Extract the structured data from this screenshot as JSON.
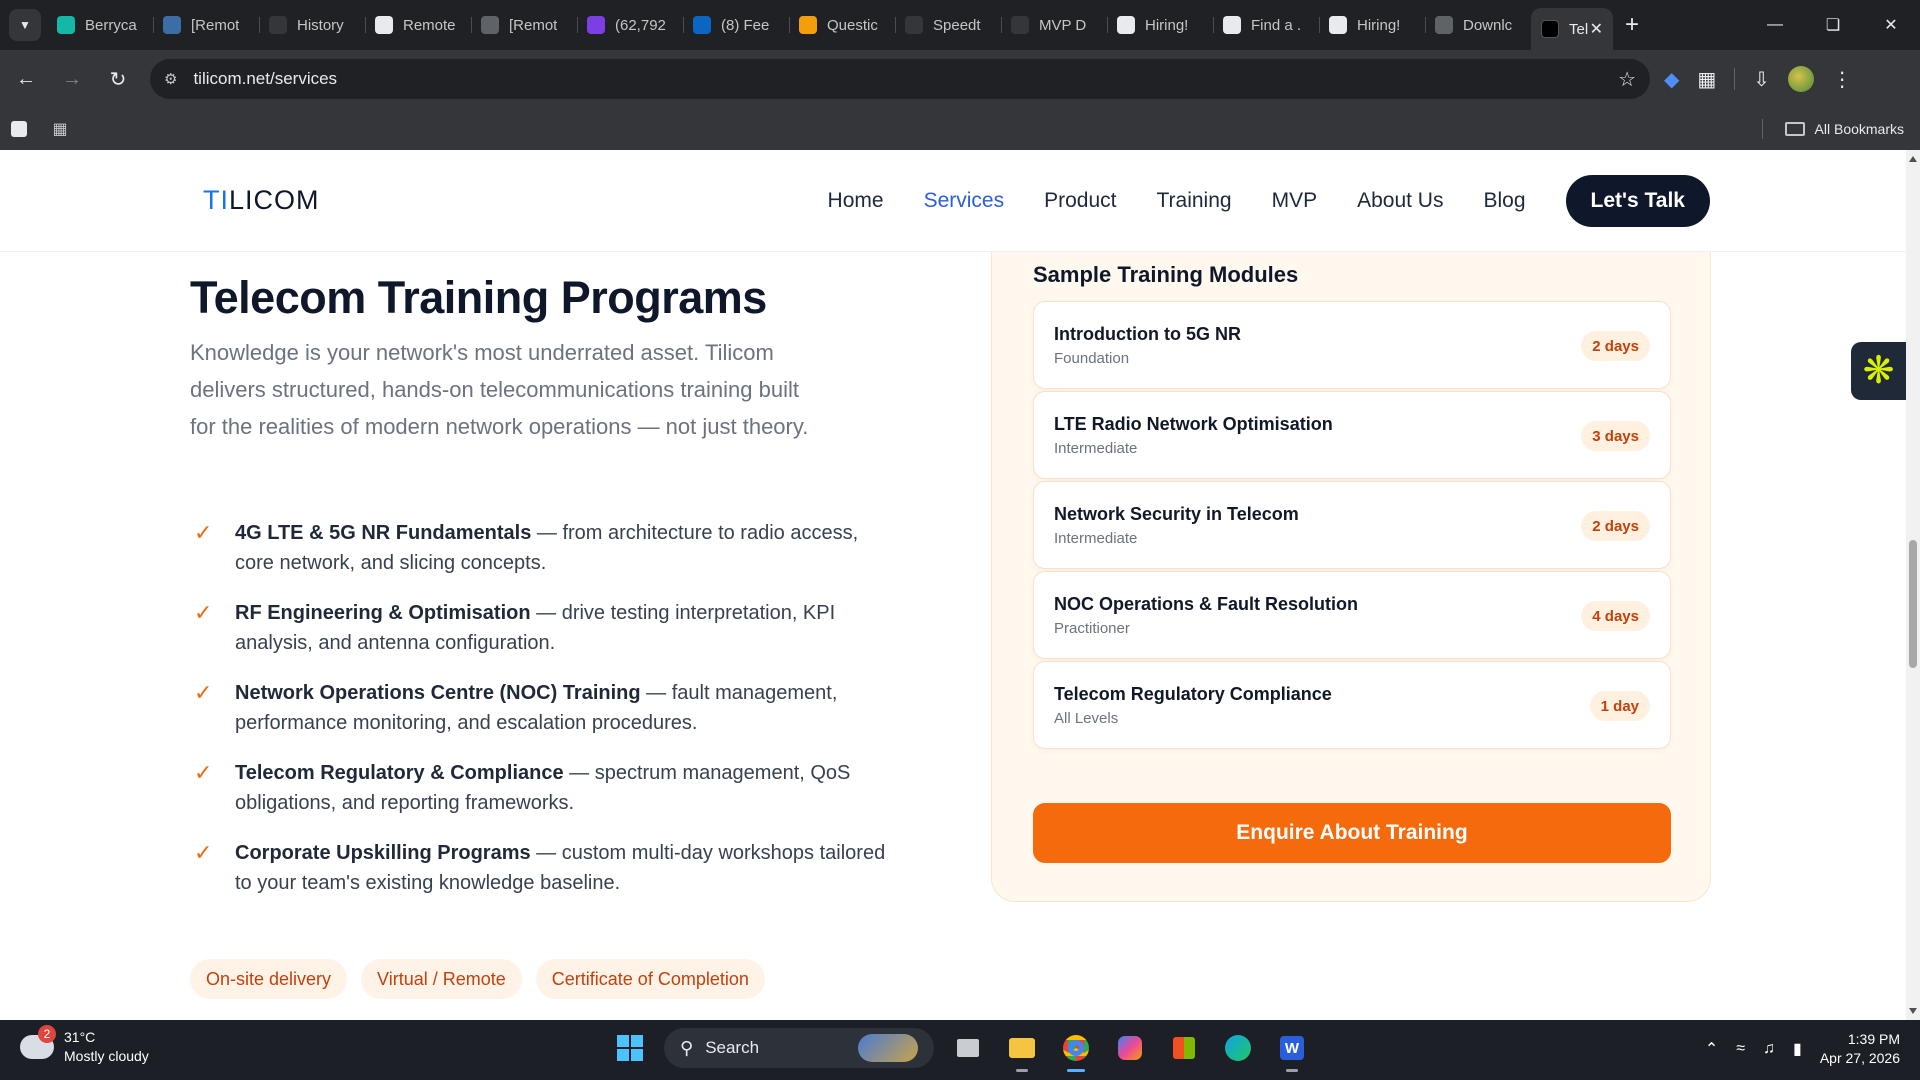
{
  "browser": {
    "tabs": [
      {
        "label": "Berryca",
        "icon": "berry-icon",
        "color": "#14b8a6"
      },
      {
        "label": "[Remot",
        "icon": "wordpress-icon",
        "color": "#3b6ea5"
      },
      {
        "label": "History",
        "icon": "history-icon",
        "color": "#35363a"
      },
      {
        "label": "Remote",
        "icon": "app-icon",
        "color": "#e8eaed"
      },
      {
        "label": "[Remot",
        "icon": "globe-icon",
        "color": "#5f6368"
      },
      {
        "label": "(62,792",
        "icon": "mail-icon",
        "color": "#7b3fe4"
      },
      {
        "label": "(8) Fee",
        "icon": "linkedin-icon",
        "color": "#0a66c2"
      },
      {
        "label": "Questic",
        "icon": "questions-icon",
        "color": "#f59e0b"
      },
      {
        "label": "Speedt",
        "icon": "speedtest-icon",
        "color": "#35363a"
      },
      {
        "label": "MVP D",
        "icon": "openai-icon",
        "color": "#35363a"
      },
      {
        "label": "Hiring!",
        "icon": "page-icon",
        "color": "#e8eaed"
      },
      {
        "label": "Find a .",
        "icon": "page-icon",
        "color": "#e8eaed"
      },
      {
        "label": "Hiring!",
        "icon": "page-icon",
        "color": "#e8eaed"
      },
      {
        "label": "Downlc",
        "icon": "globe-icon",
        "color": "#5f6368"
      }
    ],
    "active_tab": {
      "label": "Tel",
      "icon": "tilicom-icon"
    },
    "url": "tilicom.net/services",
    "bookmarks_label": "All Bookmarks"
  },
  "site": {
    "logo_prefix": "TI",
    "logo_rest": "LICOM",
    "nav": [
      {
        "label": "Home",
        "active": false
      },
      {
        "label": "Services",
        "active": true
      },
      {
        "label": "Product",
        "active": false
      },
      {
        "label": "Training",
        "active": false
      },
      {
        "label": "MVP",
        "active": false
      },
      {
        "label": "About Us",
        "active": false
      },
      {
        "label": "Blog",
        "active": false
      }
    ],
    "cta": "Let's Talk",
    "accent": "#f46a0c",
    "link_blue": "#2b5fd9",
    "dark": "#0f172a"
  },
  "main": {
    "title": "Telecom Training Programs",
    "intro": "Knowledge is your network's most underrated asset. Tilicom delivers structured, hands-on telecommunications training built for the realities of modern network operations — not just theory.",
    "features": [
      {
        "bold": "4G LTE & 5G NR Fundamentals",
        "text": " — from architecture to radio access, core network, and slicing concepts."
      },
      {
        "bold": "RF Engineering & Optimisation",
        "text": " — drive testing interpretation, KPI analysis, and antenna configuration."
      },
      {
        "bold": "Network Operations Centre (NOC) Training",
        "text": " — fault management, performance monitoring, and escalation procedures."
      },
      {
        "bold": "Telecom Regulatory & Compliance",
        "text": " — spectrum management, QoS obligations, and reporting frameworks."
      },
      {
        "bold": "Corporate Upskilling Programs",
        "text": " — custom multi-day workshops tailored to your team's existing knowledge baseline."
      }
    ],
    "chips": [
      "On-site delivery",
      "Virtual / Remote",
      "Certificate of Completion"
    ],
    "modules_title": "Sample Training Modules",
    "modules": [
      {
        "name": "Introduction to 5G NR",
        "level": "Foundation",
        "duration": "2 days"
      },
      {
        "name": "LTE Radio Network Optimisation",
        "level": "Intermediate",
        "duration": "3 days"
      },
      {
        "name": "Network Security in Telecom",
        "level": "Intermediate",
        "duration": "2 days"
      },
      {
        "name": "NOC Operations & Fault Resolution",
        "level": "Practitioner",
        "duration": "4 days"
      },
      {
        "name": "Telecom Regulatory Compliance",
        "level": "All Levels",
        "duration": "1 day"
      }
    ],
    "enquire": "Enquire About Training"
  },
  "taskbar": {
    "weather_temp": "31°C",
    "weather_desc": "Mostly cloudy",
    "weather_badge": "2",
    "search_label": "Search",
    "time": "1:39 PM",
    "date": "Apr 27, 2026"
  }
}
